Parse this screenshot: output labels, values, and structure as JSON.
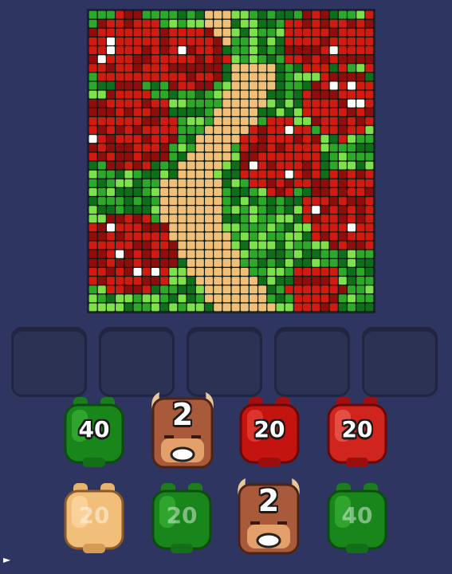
{
  "board": {
    "colors": {
      "dark_green": "#0f6e1c",
      "green": "#2ea82a",
      "light_green": "#7ee04a",
      "red": "#d11a12",
      "dark_red": "#8f0d0d",
      "tan": "#f0c07a",
      "white": "#ffffff"
    }
  },
  "slots": {
    "count": 5,
    "states": [
      "empty",
      "empty",
      "empty",
      "empty",
      "empty"
    ]
  },
  "pieces": {
    "row1": [
      {
        "kind": "jar",
        "color": "green",
        "count": "40",
        "active": true
      },
      {
        "kind": "bull",
        "color": "brown",
        "count": "2",
        "active": true
      },
      {
        "kind": "jar",
        "color": "red",
        "count": "20",
        "active": true
      },
      {
        "kind": "jar",
        "color": "red",
        "count": "20",
        "active": true
      }
    ],
    "row2": [
      {
        "kind": "jar",
        "color": "tan",
        "count": "20",
        "active": false
      },
      {
        "kind": "jar",
        "color": "green",
        "count": "20",
        "active": false
      },
      {
        "kind": "bull",
        "color": "brown",
        "count": "2",
        "active": true
      },
      {
        "kind": "jar",
        "color": "green",
        "count": "40",
        "active": false
      }
    ]
  }
}
